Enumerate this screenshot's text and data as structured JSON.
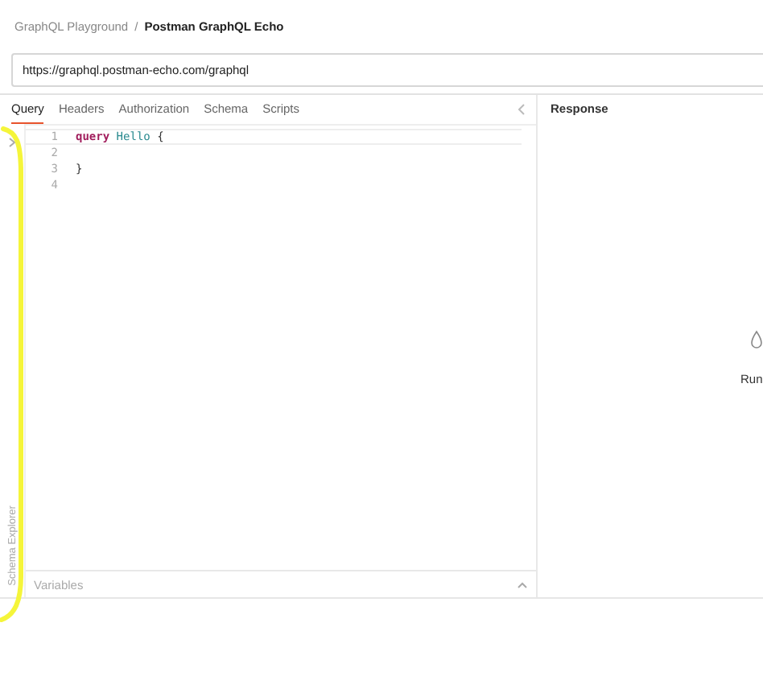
{
  "breadcrumb": [
    {
      "label": "GraphQL Playground",
      "current": false
    },
    {
      "label": "Postman GraphQL Echo",
      "current": true
    }
  ],
  "separator": "/",
  "url_field": {
    "value": "https://graphql.postman-echo.com/graphql"
  },
  "tabs": [
    {
      "label": "Query",
      "selected": true
    },
    {
      "label": "Headers",
      "selected": false
    },
    {
      "label": "Authorization",
      "selected": false
    },
    {
      "label": "Schema",
      "selected": false
    },
    {
      "label": "Scripts",
      "selected": false
    }
  ],
  "schema_explorer": {
    "label": "Schema Explorer"
  },
  "editor": {
    "lines": [
      {
        "number": "1",
        "active": true,
        "tokens": [
          {
            "kind": "keyword",
            "text": "query"
          },
          {
            "kind": "name",
            "text": "Hello"
          },
          {
            "kind": "punct",
            "text": "{"
          }
        ]
      },
      {
        "number": "2",
        "active": false
      },
      {
        "number": "3",
        "active": false,
        "tokens": [
          {
            "kind": "punct",
            "text": "}"
          }
        ]
      },
      {
        "number": "4",
        "active": false
      }
    ]
  },
  "variables": {
    "label": "Variables"
  },
  "response": {
    "title": "Response",
    "hint": "Run"
  }
}
